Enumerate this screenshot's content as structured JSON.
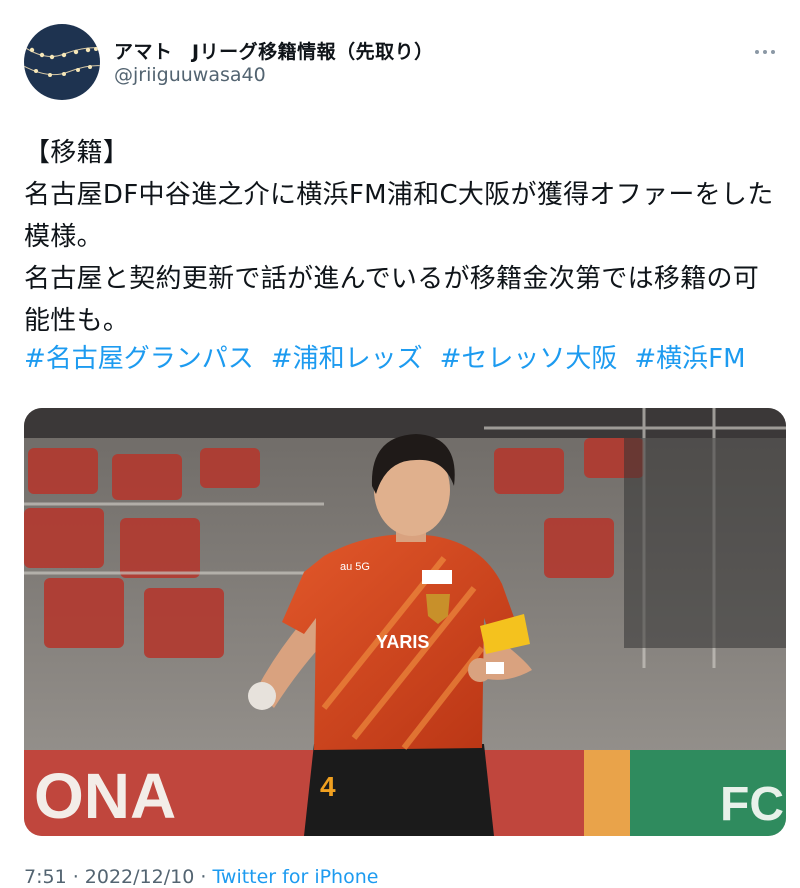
{
  "user": {
    "display_name": "アマト　Jリーグ移籍情報（先取り）",
    "handle": "@jriiguuwasa40"
  },
  "tweet": {
    "body": "【移籍】\n名古屋DF中谷進之介に横浜FM浦和C大阪が獲得オファーをした模様。\n名古屋と契約更新で話が進んでいるが移籍金次第では移籍の可能性も。",
    "hashtags": [
      "#名古屋グランパス",
      "#浦和レッズ",
      "#セレッソ大阪",
      "#横浜FM"
    ]
  },
  "media": {
    "icon": "football-player-photo",
    "shirt_sponsor": "YARIS",
    "shirt_partner": "au 5G",
    "shirt_number": "4"
  },
  "meta": {
    "time": "7:51",
    "date": "2022/12/10",
    "separator": " · ",
    "source": "Twitter for iPhone"
  },
  "colors": {
    "link": "#1d9bf0",
    "secondary_text": "#536471",
    "kit_orange": "#d8481f",
    "kit_dark": "#1b1b1b",
    "captain_band": "#f4c21e"
  }
}
